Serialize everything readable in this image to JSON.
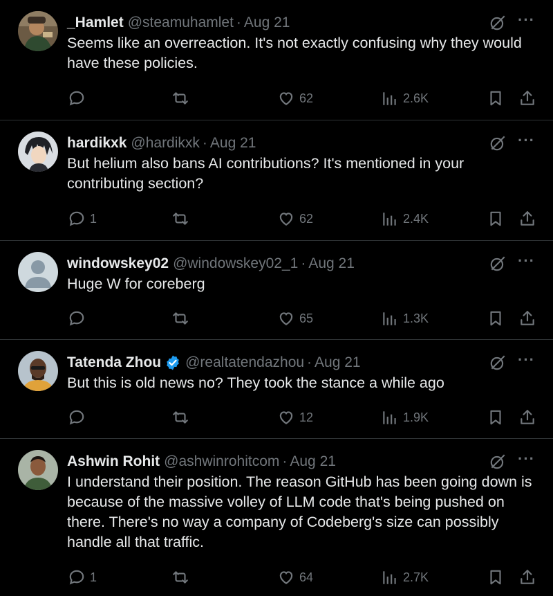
{
  "tweets": [
    {
      "name": "_Hamlet",
      "handle": "@steamuhamlet",
      "separator": "·",
      "date": "Aug 21",
      "verified": false,
      "text": "Seems like an overreaction. It's not exactly confusing why they would have these policies.",
      "replies": "",
      "likes": "62",
      "views": "2.6K"
    },
    {
      "name": "hardikxk",
      "handle": "@hardikxk",
      "separator": "·",
      "date": "Aug 21",
      "verified": false,
      "text": "But helium also bans AI contributions? It's mentioned in your contributing section?",
      "replies": "1",
      "likes": "62",
      "views": "2.4K"
    },
    {
      "name": "windowskey02",
      "handle": "@windowskey02_1",
      "separator": "·",
      "date": "Aug 21",
      "verified": false,
      "text": "Huge W for coreberg",
      "replies": "",
      "likes": "65",
      "views": "1.3K"
    },
    {
      "name": "Tatenda Zhou",
      "handle": "@realtatendazhou",
      "separator": "·",
      "date": "Aug 21",
      "verified": true,
      "text": "But this is old news no? They took the stance a while ago",
      "replies": "",
      "likes": "12",
      "views": "1.9K"
    },
    {
      "name": "Ashwin Rohit",
      "handle": "@ashwinrohitcom",
      "separator": "·",
      "date": "Aug 21",
      "verified": false,
      "text": "I understand their position. The reason GitHub has been going down is because of the massive volley of LLM code that's being pushed on there. There's no way a company of Codeberg's size can possibly handle all that traffic.",
      "replies": "1",
      "likes": "64",
      "views": "2.7K"
    }
  ],
  "more_label": "···",
  "colors": {
    "background": "#000000",
    "text": "#e7e9ea",
    "muted": "#71767b",
    "divider": "#2f3336",
    "verified": "#1d9bf0"
  },
  "icons": [
    "reply-icon",
    "retweet-icon",
    "like-icon",
    "views-icon",
    "bookmark-icon",
    "share-icon",
    "grok-icon",
    "more-icon",
    "verified-badge-icon"
  ]
}
